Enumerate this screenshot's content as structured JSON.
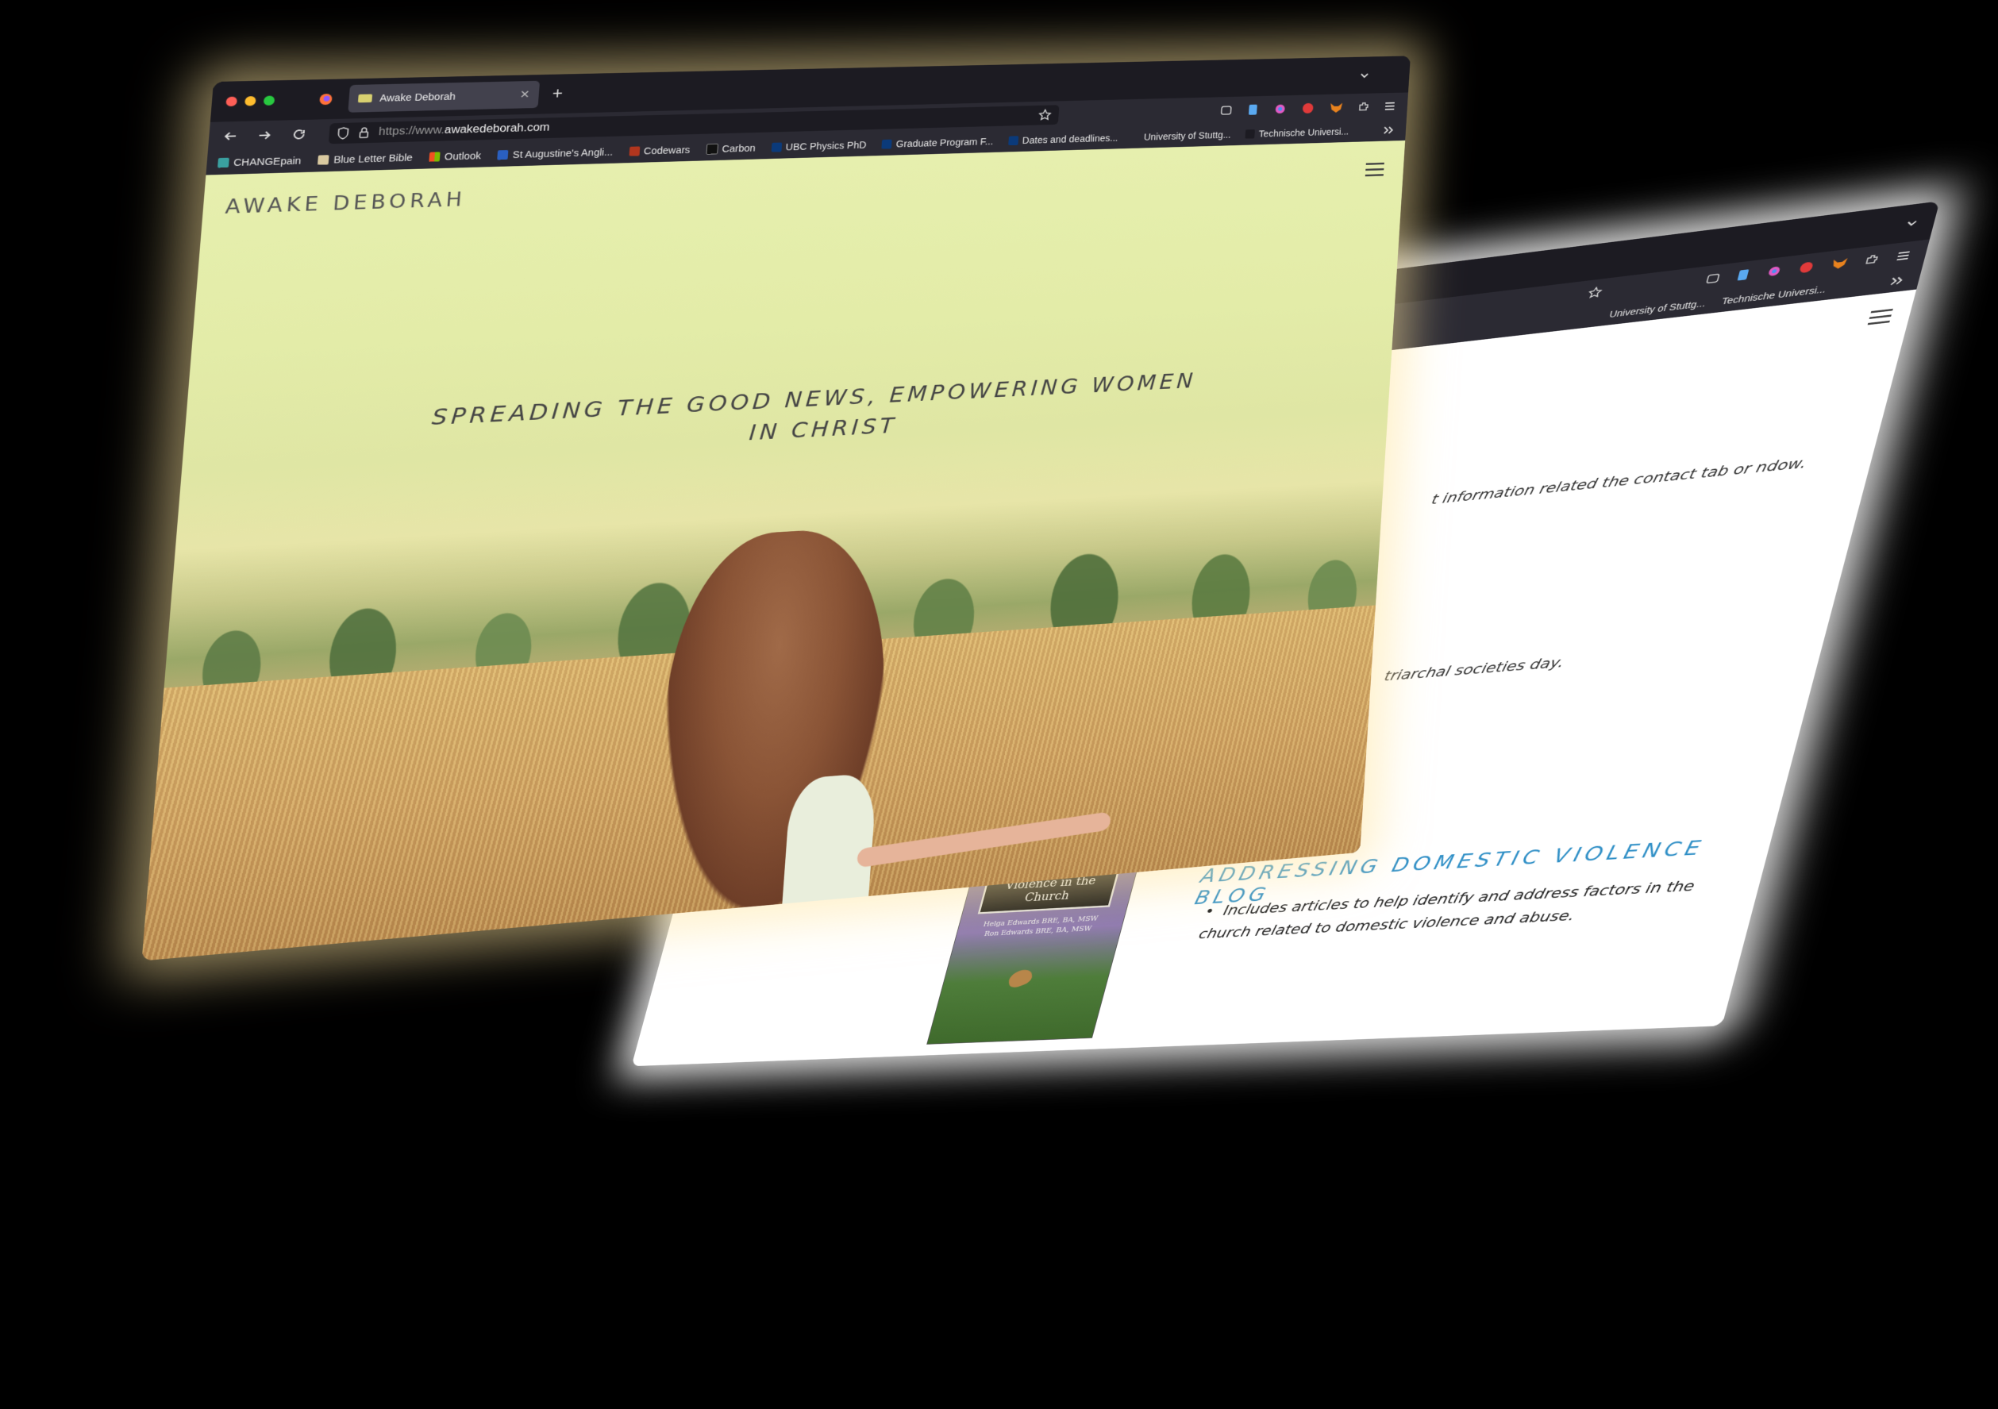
{
  "front_window": {
    "tab": {
      "title": "Awake Deborah"
    },
    "url": {
      "prefix": "https://www.",
      "host": "awakedeborah.com"
    },
    "bookmarks": [
      "CHANGEpain",
      "Blue Letter Bible",
      "Outlook",
      "St Augustine's Angli...",
      "Codewars",
      "Carbon",
      "UBC Physics PhD",
      "Graduate Program F...",
      "Dates and deadlines...",
      "University of Stuttg...",
      "Technische Universi..."
    ],
    "site": {
      "logo": "AWAKE DEBORAH",
      "tagline": "SPREADING THE GOOD NEWS, EMPOWERING WOMEN IN CHRIST"
    }
  },
  "back_window": {
    "bookmarks": [
      "University of Stuttg...",
      "Technische Universi..."
    ],
    "body": {
      "p1": "t information related the contact tab or ndow.",
      "p2": "triarchal societies day."
    },
    "blog": {
      "heading": "ADDRESSING DOMESTIC VIOLENCE BLOG",
      "bullet": "Includes articles to help identify and address factors in the church related to domestic violence and abuse."
    },
    "book": {
      "title": "Addressing Domestic Violence in the Church",
      "authors": "Helga Edwards BRE, BA, MSW\nRon Edwards BRE, BA, MSW"
    }
  },
  "colors": {
    "accent_blue": "#2f8fc6",
    "chrome_dark": "#1c1b22",
    "toolbar": "#2b2a33"
  }
}
